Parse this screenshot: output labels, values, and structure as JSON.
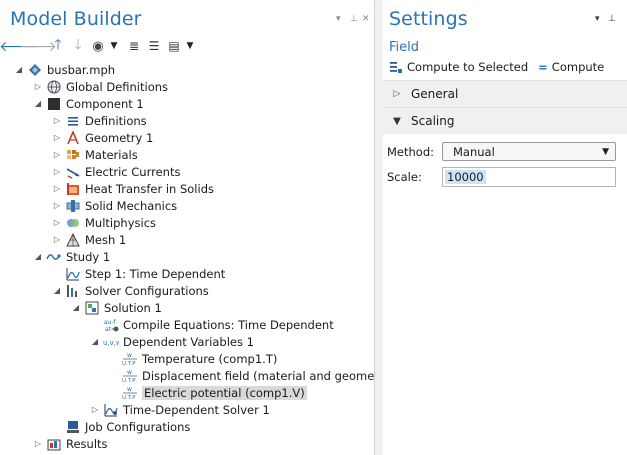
{
  "left": {
    "title": "Model Builder",
    "toolbar": [
      "arrow-left-icon",
      "arrow-right-icon",
      "arrow-up-icon",
      "arrow-down-icon",
      "eye-icon",
      "dropdown-icon",
      "expand-icon",
      "collapse-icon",
      "list-icon",
      "dropdown-icon"
    ],
    "tree": [
      {
        "label": "busbar.mph",
        "icon": "model-icon",
        "twisty": "expanded"
      },
      {
        "label": "Global Definitions",
        "icon": "globe-icon",
        "twisty": "collapsed"
      },
      {
        "label": "Component 1",
        "icon": "component-icon",
        "twisty": "expanded"
      },
      {
        "label": "Definitions",
        "icon": "definitions-icon",
        "twisty": "collapsed"
      },
      {
        "label": "Geometry 1",
        "icon": "geometry-icon",
        "twisty": "collapsed"
      },
      {
        "label": "Materials",
        "icon": "materials-icon",
        "twisty": "collapsed"
      },
      {
        "label": "Electric Currents",
        "icon": "electric-currents-icon",
        "twisty": "collapsed"
      },
      {
        "label": "Heat Transfer in Solids",
        "icon": "heat-transfer-icon",
        "twisty": "collapsed"
      },
      {
        "label": "Solid Mechanics",
        "icon": "solid-mechanics-icon",
        "twisty": "collapsed"
      },
      {
        "label": "Multiphysics",
        "icon": "multiphysics-icon",
        "twisty": "collapsed"
      },
      {
        "label": "Mesh 1",
        "icon": "mesh-icon",
        "twisty": "collapsed"
      },
      {
        "label": "Study 1",
        "icon": "study-icon",
        "twisty": "expanded"
      },
      {
        "label": "Step 1: Time Dependent",
        "icon": "time-step-icon",
        "twisty": "none"
      },
      {
        "label": "Solver Configurations",
        "icon": "solver-config-icon",
        "twisty": "expanded"
      },
      {
        "label": "Solution 1",
        "icon": "solution-icon",
        "twisty": "expanded"
      },
      {
        "label": "Compile Equations: Time Dependent",
        "icon": "compile-equations-icon",
        "twisty": "none"
      },
      {
        "label": "Dependent Variables 1",
        "icon": "dependent-variables-icon",
        "twisty": "expanded"
      },
      {
        "label": "Temperature (comp1.T)",
        "icon": "variable-icon",
        "twisty": "none"
      },
      {
        "label": "Displacement field (material and geometry",
        "icon": "variable-icon",
        "twisty": "none"
      },
      {
        "label": "Electric potential (comp1.V)",
        "icon": "variable-icon",
        "twisty": "none",
        "selected": true
      },
      {
        "label": "Time-Dependent Solver 1",
        "icon": "time-solver-icon",
        "twisty": "collapsed"
      },
      {
        "label": "Job Configurations",
        "icon": "job-config-icon",
        "twisty": "none"
      },
      {
        "label": "Results",
        "icon": "results-icon",
        "twisty": "collapsed"
      }
    ]
  },
  "right": {
    "title": "Settings",
    "subtitle": "Field",
    "compute_selected": "Compute to Selected",
    "compute": "Compute",
    "sections": {
      "general": "General",
      "scaling": "Scaling"
    },
    "method_label": "Method:",
    "method_value": "Manual",
    "scale_label": "Scale:",
    "scale_value": "10000"
  },
  "colors": {
    "accent": "#2a73b5",
    "section_bg": "#f0f0f0",
    "selection": "#d9d9d9"
  }
}
